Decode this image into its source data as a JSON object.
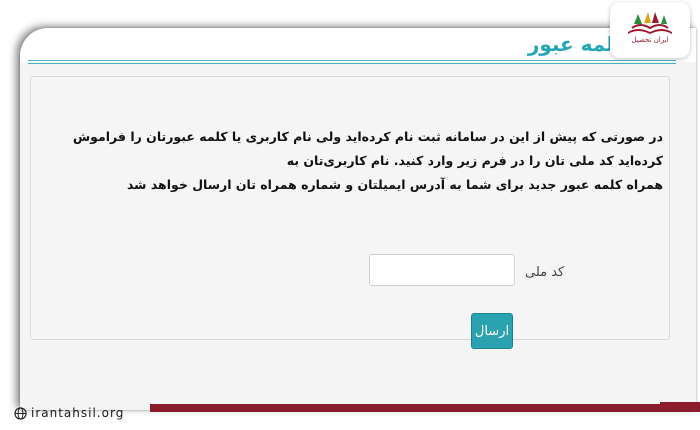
{
  "page": {
    "title": "کلمه عبور"
  },
  "form": {
    "instructions_line1": "در صورتی که پیش از این در سامانه ثبت نام کرده‌اید ولی نام کاربری یا کلمه عبورتان را فراموش کرده‌اید کد ملی تان را در فرم زیر وارد کنید. نام کاربری‌تان به",
    "instructions_line2": "همراه کلمه عبور جدید برای شما به آدرس ایمیلتان و شماره همراه تان ارسال خواهد شد",
    "national_code_label": "کد ملی",
    "national_code_value": "",
    "national_code_placeholder": "",
    "submit_label": "ارسال"
  },
  "branding": {
    "logo_text": "ایران تحصیل",
    "site_url": "irantahsil.org",
    "accent_color": "#25a6b5",
    "brand_color": "#8b1c2b"
  }
}
